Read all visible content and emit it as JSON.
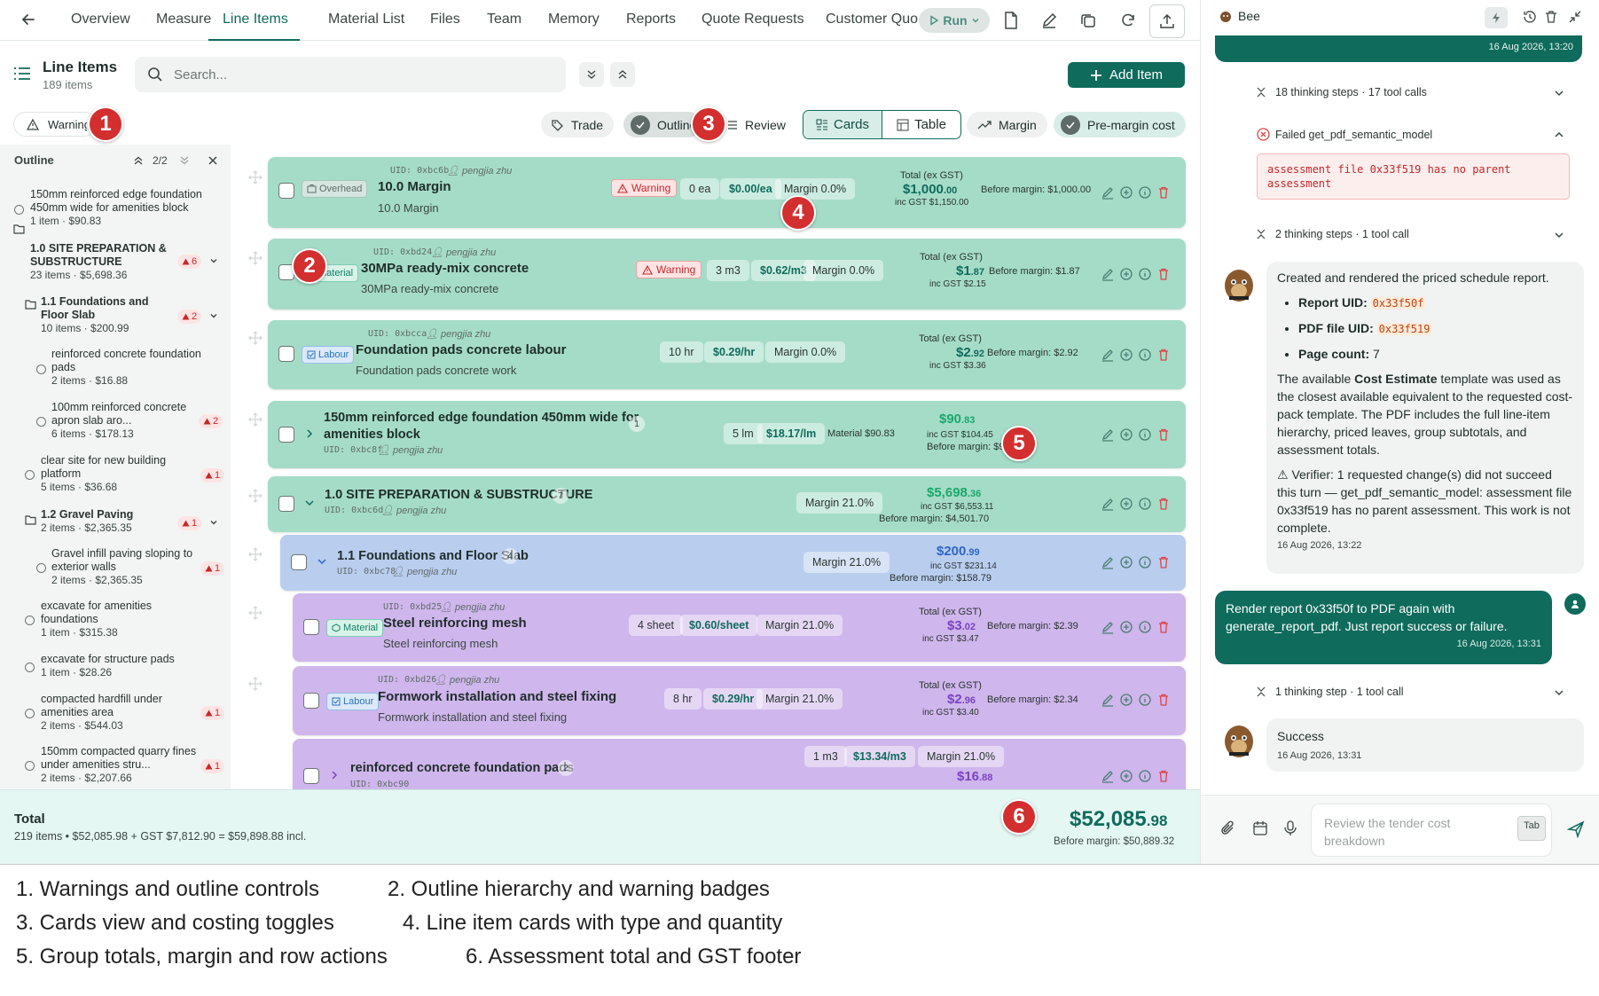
{
  "topbar": {
    "tabs": [
      {
        "label": "Overview",
        "active": false
      },
      {
        "label": "Measure",
        "active": false
      },
      {
        "label": "Line Items",
        "active": true
      },
      {
        "label": "Material List",
        "active": false
      },
      {
        "label": "Files",
        "active": false
      },
      {
        "label": "Team",
        "active": false
      },
      {
        "label": "Memory",
        "active": false
      },
      {
        "label": "Reports",
        "active": false
      },
      {
        "label": "Quote Requests",
        "active": false
      },
      {
        "label": "Customer Quot",
        "active": false
      }
    ],
    "run_label": "Run"
  },
  "header": {
    "title": "Line Items",
    "count": "189 items",
    "search_placeholder": "Search...",
    "add_item_label": "Add Item"
  },
  "toolbar": {
    "warnings_label": "Warnings",
    "trade_label": "Trade",
    "outline_label": "Outline",
    "review_label": "Review",
    "cards_label": "Cards",
    "table_label": "Table",
    "margin_label": "Margin",
    "premargin_label": "Pre-margin cost"
  },
  "sidebar": {
    "heading": "Outline",
    "nav_count": "2/2",
    "items": [
      {
        "title": "150mm reinforced edge foundation 450mm wide for amenities block",
        "sub": "1 item · $90.83",
        "badge": ""
      },
      {
        "title": "1.0 SITE PREPARATION & SUBSTRUCTURE",
        "sub": "23 items · $5,698.36",
        "badge": "6"
      },
      {
        "title": "1.1 Foundations and Floor Slab",
        "sub": "10 items · $200.99",
        "badge": "2"
      },
      {
        "title": "reinforced concrete foundation pads",
        "sub": "2 items · $16.88",
        "badge": ""
      },
      {
        "title": "100mm reinforced concrete apron slab aro...",
        "sub": "6 items · $178.13",
        "badge": "2"
      },
      {
        "title": "clear site for new building platform",
        "sub": "5 items · $36.68",
        "badge": "1"
      },
      {
        "title": "1.2 Gravel Paving",
        "sub": "2 items · $2,365.35",
        "badge": "1"
      },
      {
        "title": "Gravel infill paving sloping to exterior walls",
        "sub": "2 items · $2,365.35",
        "badge": "1"
      },
      {
        "title": "excavate for amenities foundations",
        "sub": "1 item · $315.38",
        "badge": ""
      },
      {
        "title": "excavate for structure pads",
        "sub": "1 item · $28.26",
        "badge": ""
      },
      {
        "title": "compacted hardfill under amenities area",
        "sub": "2 items · $544.03",
        "badge": "1"
      },
      {
        "title": "150mm compacted quarry fines under amenities stru...",
        "sub": "2 items · $2,207.66",
        "badge": "1"
      }
    ]
  },
  "cards": [
    {
      "uid": "UID: 0xbc6b",
      "author": "pengjia zhu",
      "type": "Overhead",
      "title": "10.0 Margin",
      "desc": "10.0 Margin",
      "warning": "Warning",
      "qty": "0 ea",
      "rate": "$0.00/ea",
      "margin": "Margin 0.0%",
      "total_label": "Total (ex GST)",
      "total_main": "$1,000",
      "total_cents": ".00",
      "gst": "inc GST $1,150.00",
      "before": "Before margin: $1,000.00"
    },
    {
      "uid": "UID: 0xbd24",
      "author": "pengjia zhu",
      "type": "Material",
      "title": "30MPa ready-mix concrete",
      "desc": "30MPa ready-mix concrete",
      "warning": "Warning",
      "qty": "3 m3",
      "rate": "$0.62/m3",
      "margin": "Margin 0.0%",
      "total_label": "Total (ex GST)",
      "total_main": "$1",
      "total_cents": ".87",
      "gst": "inc GST $2.15",
      "before": "Before margin: $1.87"
    },
    {
      "uid": "UID: 0xbcca",
      "author": "pengjia zhu",
      "type": "Labour",
      "title": "Foundation pads concrete labour",
      "desc": "Foundation pads concrete work",
      "qty": "10 hr",
      "rate": "$0.29/hr",
      "margin": "Margin 0.0%",
      "total_label": "Total (ex GST)",
      "total_main": "$2",
      "total_cents": ".92",
      "gst": "inc GST $3.36",
      "before": "Before margin: $2.92"
    },
    {
      "uid": "UID: 0xbc8f",
      "author": "pengjia zhu",
      "title": "150mm reinforced edge foundation 450mm wide for",
      "title2": "amenities block",
      "count": "1",
      "qty": "5 lm",
      "rate": "$18.17/lm",
      "material": "Material $90.83",
      "total_main": "$90",
      "total_cents": ".83",
      "gst": "inc GST $104.45",
      "before": "Before margin: $90.83"
    },
    {
      "uid": "UID: 0xbc6d",
      "author": "pengjia zhu",
      "title": "1.0 SITE PREPARATION & SUBSTRUCTURE",
      "count": "7",
      "margin": "Margin 21.0%",
      "total_main": "$5,698",
      "total_cents": ".36",
      "gst": "inc GST $6,553.11",
      "before": "Before margin: $4,501.70"
    },
    {
      "uid": "UID: 0xbc78",
      "author": "pengjia zhu",
      "title": "1.1 Foundations and Floor Slab",
      "count": "4",
      "margin": "Margin 21.0%",
      "total_main": "$200",
      "total_cents": ".99",
      "gst": "inc GST $231.14",
      "before": "Before margin: $158.79"
    },
    {
      "uid": "UID: 0xbd25",
      "author": "pengjia zhu",
      "type": "Material",
      "title": "Steel reinforcing mesh",
      "desc": "Steel reinforcing mesh",
      "qty": "4 sheet",
      "rate": "$0.60/sheet",
      "margin": "Margin 21.0%",
      "total_label": "Total (ex GST)",
      "total_main": "$3",
      "total_cents": ".02",
      "gst": "inc GST $3.47",
      "before": "Before margin: $2.39"
    },
    {
      "uid": "UID: 0xbd26",
      "author": "pengjia zhu",
      "type": "Labour",
      "title": "Formwork installation and steel fixing",
      "desc": "Formwork installation and steel fixing",
      "qty": "8 hr",
      "rate": "$0.29/hr",
      "margin": "Margin 21.0%",
      "total_label": "Total (ex GST)",
      "total_main": "$2",
      "total_cents": ".96",
      "gst": "inc GST $3.40",
      "before": "Before margin: $2.34"
    },
    {
      "uid": "UID: 0xbc90",
      "title": "reinforced concrete foundation pads",
      "count": "2",
      "qty": "1 m3",
      "rate": "$13.34/m3",
      "margin": "Margin 21.0%",
      "total_main": "$16",
      "total_cents": ".88"
    }
  ],
  "footer": {
    "label": "Total",
    "summary": "219 items • $52,085.98 + GST $7,812.90 = $59,898.88 incl.",
    "total_main": "$52,085",
    "total_cents": ".98",
    "before": "Before margin: $50,889.32"
  },
  "panel": {
    "name": "Bee",
    "top_ts": "16 Aug 2026, 13:20",
    "steps1": "18 thinking steps · 17 tool calls",
    "failed": "Failed get_pdf_semantic_model",
    "error": "assessment file 0x33f519 has no parent assessment",
    "steps2": "2 thinking steps · 1 tool call",
    "msg_intro": "Created and rendered the priced schedule report.",
    "report_uid_label": "Report UID:",
    "report_uid": "0x33f50f",
    "pdf_uid_label": "PDF file UID:",
    "pdf_uid": "0x33f519",
    "page_count_label": "Page count:",
    "page_count": "7",
    "msg_p1": "The available",
    "msg_p1_bold": "Cost Estimate",
    "msg_p1_rest": "template was used as the closest available equivalent to the requested cost-pack template. The PDF includes the full line-item hierarchy, priced leaves, group subtotals, and assessment totals.",
    "msg_verifier": "Verifier: 1 requested change(s) did not succeed this turn — get_pdf_semantic_model: assessment file 0x33f519 has no parent assessment. This work is not complete.",
    "msg_ts": "16 Aug 2026, 13:22",
    "user_msg": "Render report 0x33f50f to PDF again with generate_report_pdf. Just report success or failure.",
    "user_ts": "16 Aug 2026, 13:31",
    "steps3": "1 thinking step · 1 tool call",
    "success": "Success",
    "success_ts": "16 Aug 2026, 13:31",
    "input_placeholder": "Review the tender cost breakdown",
    "tab_key": "Tab"
  },
  "legend": [
    "1. Warnings and outline controls",
    "2. Outline hierarchy and warning badges",
    "3. Cards view and costing toggles",
    "4. Line item cards with type and quantity",
    "5. Group totals, margin and row actions",
    "6. Assessment total and GST footer"
  ],
  "markers": [
    "1",
    "2",
    "3",
    "4",
    "5",
    "6"
  ],
  "colors": {
    "accent": "#0f6b5c",
    "warning": "#c62828",
    "marker": "#d32f2f"
  }
}
